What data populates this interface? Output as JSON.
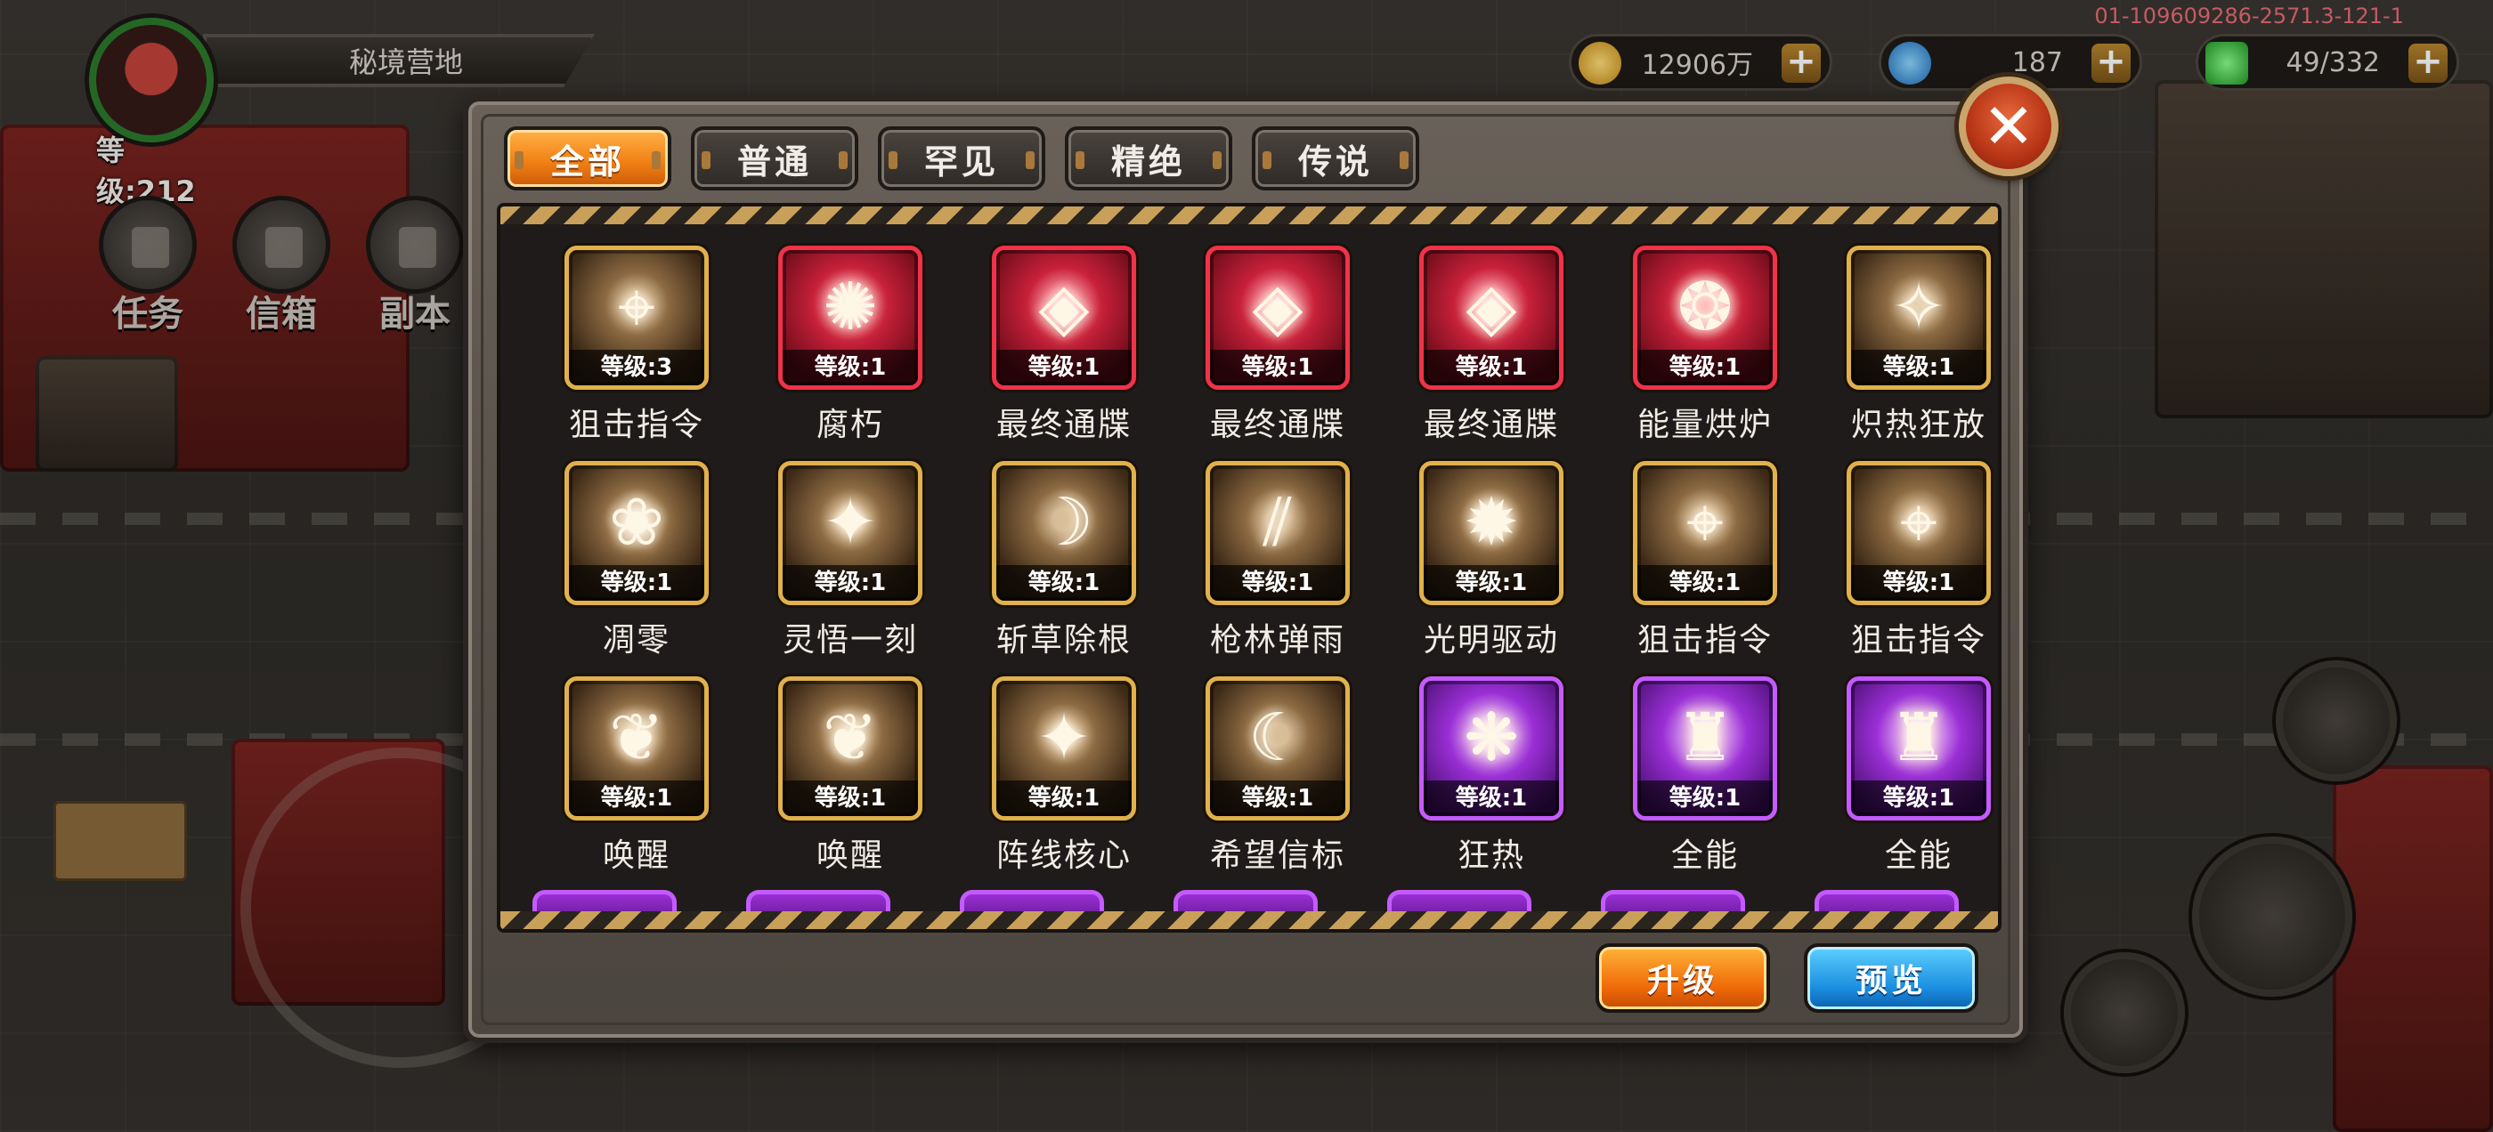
{
  "server_id": "01-109609286-2571.3-121-1",
  "player": {
    "location_name": "秘境营地",
    "level_text": "等级:212"
  },
  "side_menu": [
    {
      "label": "任务",
      "icon": "task-icon"
    },
    {
      "label": "信箱",
      "icon": "mailbox-icon"
    },
    {
      "label": "副本",
      "icon": "dungeon-icon"
    }
  ],
  "currencies": [
    {
      "name": "gold",
      "icon": "gold-coin-icon",
      "value": "12906万",
      "color": "#e3b53a"
    },
    {
      "name": "gem",
      "icon": "blue-gem-icon",
      "value": "187",
      "color": "#2e8fe0"
    },
    {
      "name": "energy",
      "icon": "green-cube-icon",
      "value": "49/332",
      "color": "#2fbf3a"
    }
  ],
  "tabs": [
    {
      "label": "全部",
      "active": true
    },
    {
      "label": "普通",
      "active": false
    },
    {
      "label": "罕见",
      "active": false
    },
    {
      "label": "精绝",
      "active": false
    },
    {
      "label": "传说",
      "active": false
    }
  ],
  "skills": [
    {
      "name": "狙击指令",
      "level": "等级:3",
      "rarity": "gold",
      "glyph": "⌖"
    },
    {
      "name": "腐朽",
      "level": "等级:1",
      "rarity": "red",
      "glyph": "✺"
    },
    {
      "name": "最终通牒",
      "level": "等级:1",
      "rarity": "red",
      "glyph": "◈"
    },
    {
      "name": "最终通牒",
      "level": "等级:1",
      "rarity": "red",
      "glyph": "◈"
    },
    {
      "name": "最终通牒",
      "level": "等级:1",
      "rarity": "red",
      "glyph": "◈"
    },
    {
      "name": "能量烘炉",
      "level": "等级:1",
      "rarity": "red",
      "glyph": "❂"
    },
    {
      "name": "炽热狂放",
      "level": "等级:1",
      "rarity": "gold",
      "glyph": "✧"
    },
    {
      "name": "凋零",
      "level": "等级:1",
      "rarity": "gold",
      "glyph": "❀"
    },
    {
      "name": "灵悟一刻",
      "level": "等级:1",
      "rarity": "gold",
      "glyph": "✦"
    },
    {
      "name": "斩草除根",
      "level": "等级:1",
      "rarity": "gold",
      "glyph": "☽"
    },
    {
      "name": "枪林弹雨",
      "level": "等级:1",
      "rarity": "gold",
      "glyph": "⫽"
    },
    {
      "name": "光明驱动",
      "level": "等级:1",
      "rarity": "gold",
      "glyph": "✹"
    },
    {
      "name": "狙击指令",
      "level": "等级:1",
      "rarity": "gold",
      "glyph": "⌖"
    },
    {
      "name": "狙击指令",
      "level": "等级:1",
      "rarity": "gold",
      "glyph": "⌖"
    },
    {
      "name": "唤醒",
      "level": "等级:1",
      "rarity": "gold",
      "glyph": "❦"
    },
    {
      "name": "唤醒",
      "level": "等级:1",
      "rarity": "gold",
      "glyph": "❦"
    },
    {
      "name": "阵线核心",
      "level": "等级:1",
      "rarity": "gold",
      "glyph": "✦"
    },
    {
      "name": "希望信标",
      "level": "等级:1",
      "rarity": "gold",
      "glyph": "☾"
    },
    {
      "name": "狂热",
      "level": "等级:1",
      "rarity": "purple",
      "glyph": "❋"
    },
    {
      "name": "全能",
      "level": "等级:1",
      "rarity": "purple",
      "glyph": "♜"
    },
    {
      "name": "全能",
      "level": "等级:1",
      "rarity": "purple",
      "glyph": "♜"
    }
  ],
  "buttons": {
    "upgrade": "升级",
    "preview": "预览",
    "close": "✕"
  }
}
